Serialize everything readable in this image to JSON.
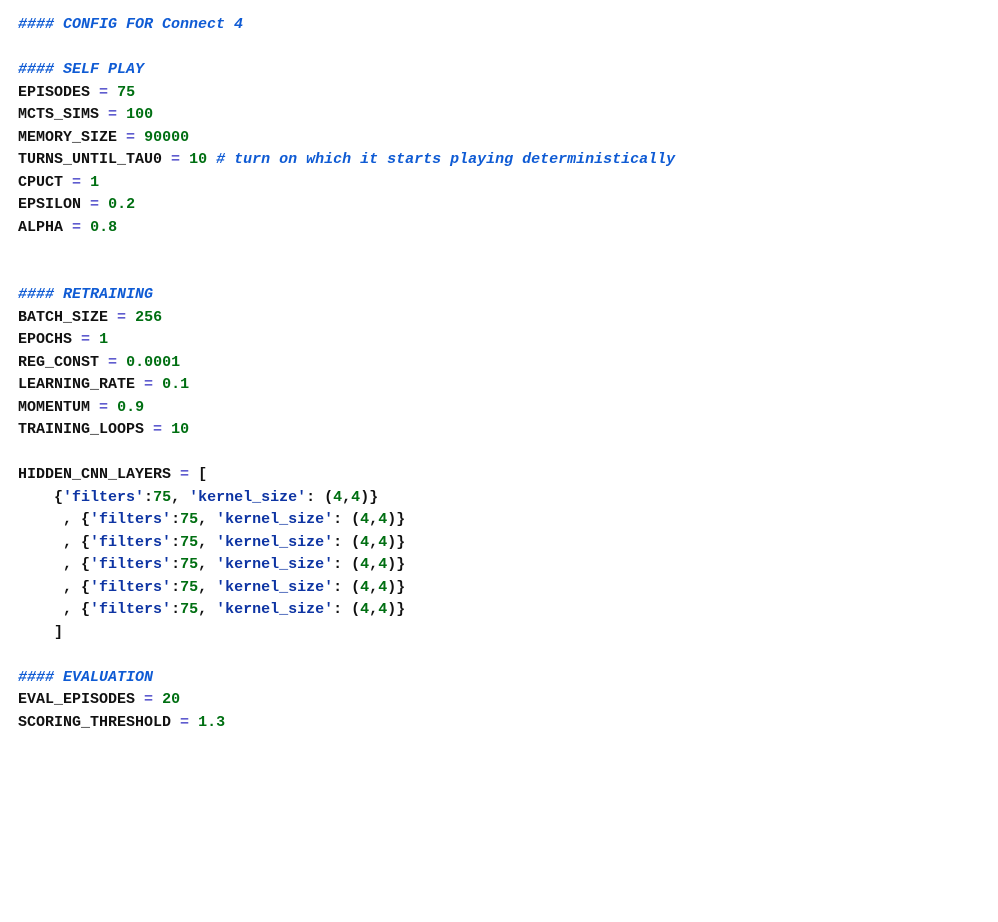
{
  "lines": [
    {
      "type": "comment",
      "text": "#### CONFIG FOR Connect 4"
    },
    {
      "type": "blank"
    },
    {
      "type": "comment",
      "text": "#### SELF PLAY"
    },
    {
      "type": "assign",
      "name": "EPISODES",
      "value": "75"
    },
    {
      "type": "assign",
      "name": "MCTS_SIMS",
      "value": "100"
    },
    {
      "type": "assign",
      "name": "MEMORY_SIZE",
      "value": "90000"
    },
    {
      "type": "assign",
      "name": "TURNS_UNTIL_TAU0",
      "value": "10",
      "trailing_comment": "# turn on which it starts playing deterministically"
    },
    {
      "type": "assign",
      "name": "CPUCT",
      "value": "1"
    },
    {
      "type": "assign",
      "name": "EPSILON",
      "value": "0.2"
    },
    {
      "type": "assign",
      "name": "ALPHA",
      "value": "0.8"
    },
    {
      "type": "blank"
    },
    {
      "type": "blank"
    },
    {
      "type": "comment",
      "text": "#### RETRAINING"
    },
    {
      "type": "assign",
      "name": "BATCH_SIZE",
      "value": "256"
    },
    {
      "type": "assign",
      "name": "EPOCHS",
      "value": "1"
    },
    {
      "type": "assign",
      "name": "REG_CONST",
      "value": "0.0001"
    },
    {
      "type": "assign",
      "name": "LEARNING_RATE",
      "value": "0.1"
    },
    {
      "type": "assign",
      "name": "MOMENTUM",
      "value": "0.9"
    },
    {
      "type": "assign",
      "name": "TRAINING_LOOPS",
      "value": "10"
    },
    {
      "type": "blank"
    },
    {
      "type": "list_open",
      "name": "HIDDEN_CNN_LAYERS"
    },
    {
      "type": "dict_first",
      "indent": "    ",
      "k1": "filters",
      "v1": "75",
      "k2": "kernel_size",
      "tuple": [
        "4",
        "4"
      ]
    },
    {
      "type": "dict_commafirst",
      "indent": "     ",
      "k1": "filters",
      "v1": "75",
      "k2": "kernel_size",
      "tuple": [
        "4",
        "4"
      ]
    },
    {
      "type": "dict_commafirst",
      "indent": "     ",
      "k1": "filters",
      "v1": "75",
      "k2": "kernel_size",
      "tuple": [
        "4",
        "4"
      ]
    },
    {
      "type": "dict_commafirst",
      "indent": "     ",
      "k1": "filters",
      "v1": "75",
      "k2": "kernel_size",
      "tuple": [
        "4",
        "4"
      ]
    },
    {
      "type": "dict_commafirst",
      "indent": "     ",
      "k1": "filters",
      "v1": "75",
      "k2": "kernel_size",
      "tuple": [
        "4",
        "4"
      ]
    },
    {
      "type": "dict_commafirst",
      "indent": "     ",
      "k1": "filters",
      "v1": "75",
      "k2": "kernel_size",
      "tuple": [
        "4",
        "4"
      ]
    },
    {
      "type": "list_close",
      "indent": "    "
    },
    {
      "type": "blank"
    },
    {
      "type": "comment",
      "text": "#### EVALUATION"
    },
    {
      "type": "assign",
      "name": "EVAL_EPISODES",
      "value": "20"
    },
    {
      "type": "assign",
      "name": "SCORING_THRESHOLD",
      "value": "1.3"
    }
  ]
}
